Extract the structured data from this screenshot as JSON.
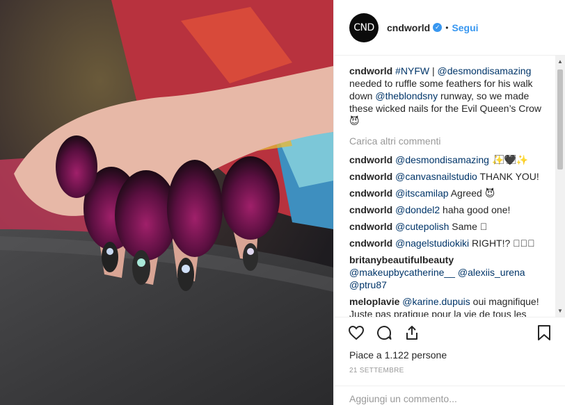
{
  "post": {
    "username": "cndworld",
    "avatar_text": "CND",
    "follow_label": "Segui",
    "dot": "•",
    "verified_glyph": "✓",
    "caption": {
      "user": "cndworld",
      "hashtag": "#NYFW",
      "sep": " | ",
      "mention1": "@desmondisamazing",
      "text1": " needed to ruffle some feathers for his walk down ",
      "mention2": "@theblondsny",
      "text2": " runway, so we made these wicked nails for the Evil Queen’s Crow 😈"
    },
    "load_more": "Carica altri commenti",
    "comments": [
      {
        "user": "cndworld",
        "mention": "@desmondisamazing",
        "text": " ✨⃞🖤⃞✨"
      },
      {
        "user": "cndworld",
        "mention": "@canvasnailstudio",
        "text": " THANK YOU!"
      },
      {
        "user": "cndworld",
        "mention": "@itscamilap",
        "text": " Agreed 😈"
      },
      {
        "user": "cndworld",
        "mention": "@dondel2",
        "text": " haha good one!"
      },
      {
        "user": "cndworld",
        "mention": "@cutepolish",
        "text": " Same ⃞"
      },
      {
        "user": "cndworld",
        "mention": "@nagelstudiokiki",
        "text": " RIGHT!? ⃞⃞⃞"
      },
      {
        "user": "britanybeautifulbeauty",
        "mention": "@makeupbycatherine__",
        "text": " ",
        "mention_b": "@alexiis_urena",
        "text_b": " ",
        "mention_c": "@ptru87"
      },
      {
        "user": "meloplavie",
        "mention": "@karine.dupuis",
        "text": " oui magnifique! Juste pas pratique pour la vie de tous les jours... sans plume par contre ce"
      }
    ],
    "likes": "Piace a 1.122 persone",
    "date": "21 SETTEMBRE",
    "add_comment_placeholder": "Aggiungi un commento..."
  },
  "colors": {
    "link": "#3897f0",
    "mention": "#003569",
    "muted": "#999999"
  },
  "icons": [
    "heart-icon",
    "comment-icon",
    "share-icon",
    "bookmark-icon",
    "verified-badge-icon"
  ]
}
